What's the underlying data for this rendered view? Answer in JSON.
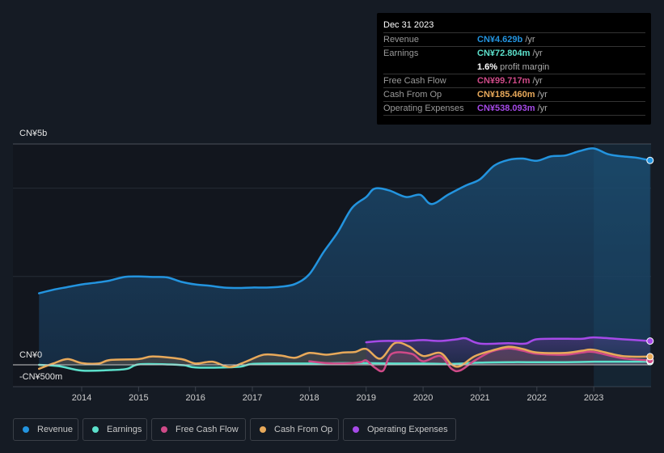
{
  "tooltip": {
    "date": "Dec 31 2023",
    "rows": [
      {
        "label": "Revenue",
        "value": "CN¥4.629b",
        "unit": " /yr",
        "color": "#2394df"
      },
      {
        "label": "Earnings",
        "value": "CN¥72.804m",
        "unit": " /yr",
        "color": "#5ce0cb"
      },
      {
        "label": "Free Cash Flow",
        "value": "CN¥99.717m",
        "unit": " /yr",
        "color": "#cf4a88"
      },
      {
        "label": "Cash From Op",
        "value": "CN¥185.460m",
        "unit": " /yr",
        "color": "#e8a95a"
      },
      {
        "label": "Operating Expenses",
        "value": "CN¥538.093m",
        "unit": " /yr",
        "color": "#a64ae8"
      }
    ],
    "margin_value": "1.6%",
    "margin_text": " profit margin"
  },
  "legend": [
    {
      "label": "Revenue",
      "color": "#2394df"
    },
    {
      "label": "Earnings",
      "color": "#5ce0cb"
    },
    {
      "label": "Free Cash Flow",
      "color": "#cf4a88"
    },
    {
      "label": "Cash From Op",
      "color": "#e8a95a"
    },
    {
      "label": "Operating Expenses",
      "color": "#a64ae8"
    }
  ],
  "chart_data": {
    "type": "area",
    "title": "",
    "xlabel": "",
    "ylabel": "",
    "currency": "CN¥",
    "y_ticks": [
      {
        "value": 5000,
        "label": "CN¥5b"
      },
      {
        "value": 0,
        "label": "CN¥0"
      },
      {
        "value": -500,
        "label": "-CN¥500m"
      }
    ],
    "ylim": [
      -500,
      5000
    ],
    "y_unit": "millions CNY",
    "xlim": [
      2012.7,
      2024.0
    ],
    "x_ticks": [
      2014,
      2015,
      2016,
      2017,
      2018,
      2019,
      2020,
      2021,
      2022,
      2023
    ],
    "highlight_from": 2023.0,
    "series": [
      {
        "name": "Revenue",
        "color": "#2394df",
        "points": [
          [
            2013.25,
            1620
          ],
          [
            2013.5,
            1700
          ],
          [
            2013.75,
            1760
          ],
          [
            2014.0,
            1820
          ],
          [
            2014.25,
            1860
          ],
          [
            2014.5,
            1910
          ],
          [
            2014.75,
            1990
          ],
          [
            2015.0,
            2000
          ],
          [
            2015.25,
            1990
          ],
          [
            2015.5,
            1980
          ],
          [
            2015.75,
            1880
          ],
          [
            2016.0,
            1820
          ],
          [
            2016.25,
            1790
          ],
          [
            2016.5,
            1750
          ],
          [
            2016.75,
            1740
          ],
          [
            2017.0,
            1750
          ],
          [
            2017.25,
            1750
          ],
          [
            2017.5,
            1770
          ],
          [
            2017.75,
            1830
          ],
          [
            2018.0,
            2050
          ],
          [
            2018.25,
            2550
          ],
          [
            2018.5,
            3000
          ],
          [
            2018.75,
            3550
          ],
          [
            2019.0,
            3800
          ],
          [
            2019.15,
            3990
          ],
          [
            2019.4,
            3950
          ],
          [
            2019.7,
            3800
          ],
          [
            2019.95,
            3850
          ],
          [
            2020.15,
            3640
          ],
          [
            2020.45,
            3860
          ],
          [
            2020.75,
            4060
          ],
          [
            2021.0,
            4200
          ],
          [
            2021.25,
            4510
          ],
          [
            2021.5,
            4640
          ],
          [
            2021.75,
            4670
          ],
          [
            2022.0,
            4620
          ],
          [
            2022.25,
            4720
          ],
          [
            2022.5,
            4740
          ],
          [
            2022.75,
            4840
          ],
          [
            2023.0,
            4900
          ],
          [
            2023.25,
            4770
          ],
          [
            2023.5,
            4720
          ],
          [
            2023.75,
            4690
          ],
          [
            2023.99,
            4629
          ]
        ]
      },
      {
        "name": "Earnings",
        "color": "#5ce0cb",
        "points": [
          [
            2013.25,
            0
          ],
          [
            2013.6,
            -30
          ],
          [
            2014.0,
            -130
          ],
          [
            2014.5,
            -120
          ],
          [
            2014.8,
            -90
          ],
          [
            2015.0,
            10
          ],
          [
            2015.5,
            10
          ],
          [
            2015.8,
            -10
          ],
          [
            2016.0,
            -60
          ],
          [
            2016.5,
            -60
          ],
          [
            2016.8,
            -40
          ],
          [
            2017.0,
            20
          ],
          [
            2017.5,
            30
          ],
          [
            2018.0,
            30
          ],
          [
            2018.5,
            40
          ],
          [
            2019.0,
            40
          ],
          [
            2019.5,
            30
          ],
          [
            2020.0,
            30
          ],
          [
            2020.5,
            20
          ],
          [
            2021.0,
            50
          ],
          [
            2021.5,
            60
          ],
          [
            2022.0,
            60
          ],
          [
            2022.5,
            60
          ],
          [
            2023.0,
            70
          ],
          [
            2023.5,
            70
          ],
          [
            2023.99,
            73
          ]
        ]
      },
      {
        "name": "Free Cash Flow",
        "color": "#cf4a88",
        "points": [
          [
            2018.0,
            80
          ],
          [
            2018.3,
            40
          ],
          [
            2018.6,
            30
          ],
          [
            2018.9,
            60
          ],
          [
            2019.0,
            100
          ],
          [
            2019.15,
            -60
          ],
          [
            2019.3,
            -130
          ],
          [
            2019.45,
            250
          ],
          [
            2019.8,
            250
          ],
          [
            2020.0,
            80
          ],
          [
            2020.3,
            200
          ],
          [
            2020.5,
            -90
          ],
          [
            2020.65,
            -130
          ],
          [
            2020.9,
            90
          ],
          [
            2021.2,
            300
          ],
          [
            2021.5,
            370
          ],
          [
            2021.75,
            320
          ],
          [
            2022.0,
            250
          ],
          [
            2022.5,
            230
          ],
          [
            2022.8,
            280
          ],
          [
            2023.0,
            290
          ],
          [
            2023.5,
            150
          ],
          [
            2023.99,
            100
          ]
        ]
      },
      {
        "name": "Cash From Op",
        "color": "#e8a95a",
        "points": [
          [
            2013.25,
            -90
          ],
          [
            2013.5,
            30
          ],
          [
            2013.75,
            130
          ],
          [
            2014.0,
            40
          ],
          [
            2014.3,
            30
          ],
          [
            2014.5,
            110
          ],
          [
            2015.0,
            130
          ],
          [
            2015.25,
            190
          ],
          [
            2015.75,
            130
          ],
          [
            2016.0,
            30
          ],
          [
            2016.3,
            70
          ],
          [
            2016.6,
            -50
          ],
          [
            2016.9,
            80
          ],
          [
            2017.2,
            230
          ],
          [
            2017.5,
            210
          ],
          [
            2017.75,
            160
          ],
          [
            2018.0,
            270
          ],
          [
            2018.3,
            230
          ],
          [
            2018.6,
            280
          ],
          [
            2018.8,
            290
          ],
          [
            2019.0,
            360
          ],
          [
            2019.25,
            140
          ],
          [
            2019.5,
            490
          ],
          [
            2019.75,
            420
          ],
          [
            2020.0,
            200
          ],
          [
            2020.3,
            270
          ],
          [
            2020.5,
            10
          ],
          [
            2020.65,
            -30
          ],
          [
            2020.9,
            190
          ],
          [
            2021.2,
            320
          ],
          [
            2021.5,
            410
          ],
          [
            2021.75,
            360
          ],
          [
            2022.0,
            280
          ],
          [
            2022.5,
            270
          ],
          [
            2022.8,
            320
          ],
          [
            2023.0,
            340
          ],
          [
            2023.5,
            200
          ],
          [
            2023.99,
            185
          ]
        ]
      },
      {
        "name": "Operating Expenses",
        "color": "#a64ae8",
        "points": [
          [
            2019.0,
            510
          ],
          [
            2019.3,
            540
          ],
          [
            2019.7,
            540
          ],
          [
            2020.0,
            560
          ],
          [
            2020.3,
            540
          ],
          [
            2020.6,
            580
          ],
          [
            2020.75,
            600
          ],
          [
            2021.0,
            480
          ],
          [
            2021.5,
            490
          ],
          [
            2021.8,
            480
          ],
          [
            2022.0,
            580
          ],
          [
            2022.5,
            590
          ],
          [
            2022.8,
            590
          ],
          [
            2023.0,
            620
          ],
          [
            2023.5,
            580
          ],
          [
            2023.99,
            538
          ]
        ]
      }
    ]
  }
}
